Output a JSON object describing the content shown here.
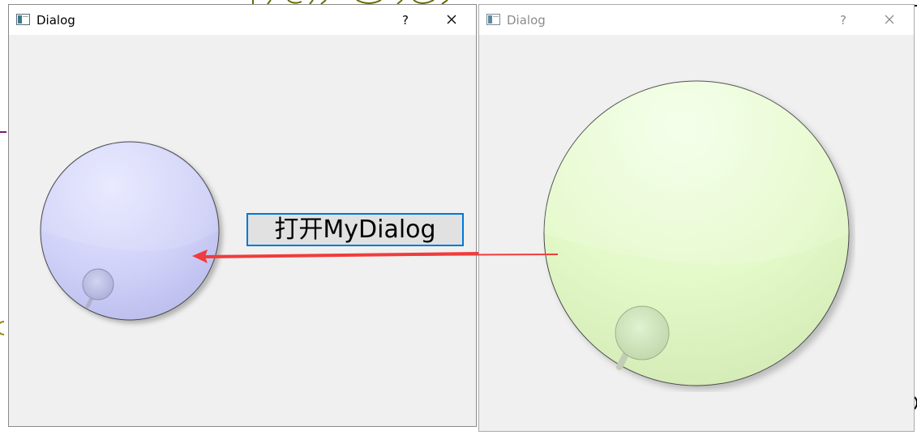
{
  "dialogs": {
    "left": {
      "title": "Dialog",
      "help_label": "?",
      "open_button_label": "打开MyDialog",
      "dial_color": "#c4c6f4"
    },
    "right": {
      "title": "Dialog",
      "help_label": "?",
      "dial_color": "#e3f9c8"
    }
  },
  "colors": {
    "annotation_arrow": "#f03c3c",
    "button_border": "#0078d7",
    "dialog_background": "#f0f0f0"
  },
  "icons": {
    "app": "window-icon",
    "close": "close-icon",
    "help": "question-mark"
  }
}
